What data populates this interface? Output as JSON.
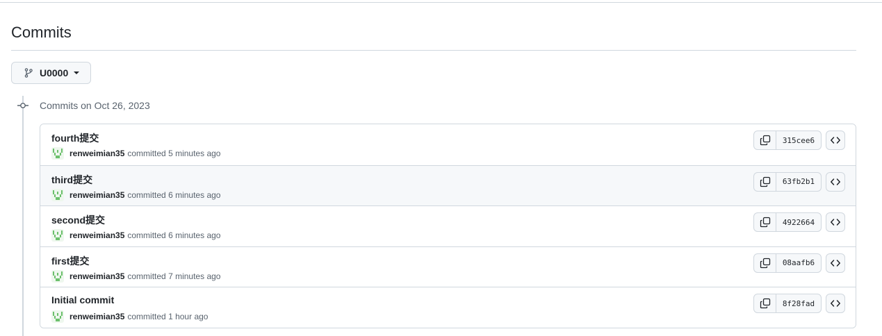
{
  "page": {
    "title": "Commits"
  },
  "branch": {
    "name": "U0000",
    "icon": "git-branch-icon"
  },
  "group": {
    "heading": "Commits on Oct 26, 2023"
  },
  "commits": [
    {
      "message": "fourth提交",
      "author": "renweimian35",
      "action": "committed",
      "time": "5 minutes ago",
      "sha": "315cee6"
    },
    {
      "message": "third提交",
      "author": "renweimian35",
      "action": "committed",
      "time": "6 minutes ago",
      "sha": "63fb2b1"
    },
    {
      "message": "second提交",
      "author": "renweimian35",
      "action": "committed",
      "time": "6 minutes ago",
      "sha": "4922664"
    },
    {
      "message": "first提交",
      "author": "renweimian35",
      "action": "committed",
      "time": "7 minutes ago",
      "sha": "08aafb6"
    },
    {
      "message": "Initial commit",
      "author": "renweimian35",
      "action": "committed",
      "time": "1 hour ago",
      "sha": "8f28fad"
    }
  ],
  "colors": {
    "avatar": "#6cc06c",
    "border": "#d0d7de",
    "muted": "#59636e",
    "hover_row": "#f6f8fa"
  }
}
